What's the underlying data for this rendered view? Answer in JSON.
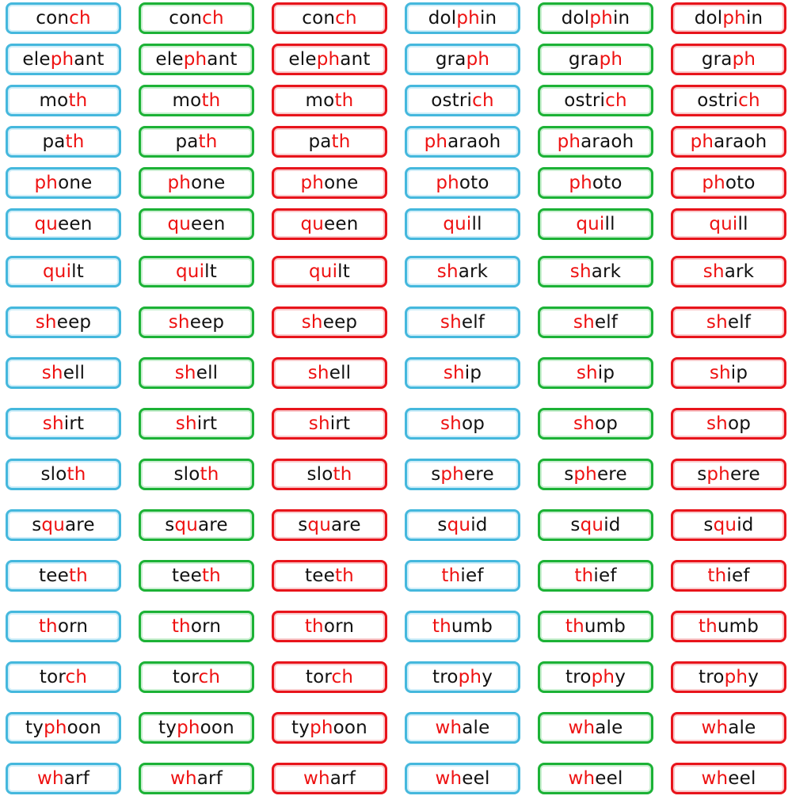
{
  "theme": {
    "blue": "#45b8dd",
    "green": "#1cb236",
    "red": "#e8141b",
    "highlight": "#ee1111",
    "text": "#111111"
  },
  "card_colors": [
    "blue",
    "green",
    "red"
  ],
  "rows": [
    {
      "words": [
        {
          "pre": "con",
          "hl": "ch",
          "post": ""
        },
        {
          "pre": "dol",
          "hl": "ph",
          "post": "in"
        }
      ]
    },
    {
      "words": [
        {
          "pre": "ele",
          "hl": "ph",
          "post": "ant"
        },
        {
          "pre": "gra",
          "hl": "ph",
          "post": ""
        }
      ]
    },
    {
      "words": [
        {
          "pre": "mo",
          "hl": "th",
          "post": ""
        },
        {
          "pre": "ostri",
          "hl": "ch",
          "post": ""
        }
      ]
    },
    {
      "words": [
        {
          "pre": "pa",
          "hl": "th",
          "post": ""
        },
        {
          "pre": "",
          "hl": "ph",
          "post": "araoh"
        }
      ]
    },
    {
      "words": [
        {
          "pre": "",
          "hl": "ph",
          "post": "one"
        },
        {
          "pre": "",
          "hl": "ph",
          "post": "oto"
        }
      ]
    },
    {
      "words": [
        {
          "pre": "",
          "hl": "qu",
          "post": "een"
        },
        {
          "pre": "",
          "hl": "qui",
          "post": "ll"
        }
      ]
    },
    {
      "words": [
        {
          "pre": "",
          "hl": "qui",
          "post": "lt"
        },
        {
          "pre": "",
          "hl": "sh",
          "post": "ark"
        }
      ]
    },
    {
      "words": [
        {
          "pre": "",
          "hl": "sh",
          "post": "eep"
        },
        {
          "pre": "",
          "hl": "sh",
          "post": "elf"
        }
      ]
    },
    {
      "words": [
        {
          "pre": "",
          "hl": "sh",
          "post": "ell"
        },
        {
          "pre": "",
          "hl": "sh",
          "post": "ip"
        }
      ]
    },
    {
      "words": [
        {
          "pre": "",
          "hl": "sh",
          "post": "irt"
        },
        {
          "pre": "",
          "hl": "sh",
          "post": "op"
        }
      ]
    },
    {
      "words": [
        {
          "pre": "slo",
          "hl": "th",
          "post": ""
        },
        {
          "pre": "s",
          "hl": "ph",
          "post": "ere"
        }
      ]
    },
    {
      "words": [
        {
          "pre": "s",
          "hl": "qu",
          "post": "are"
        },
        {
          "pre": "s",
          "hl": "qu",
          "post": "id"
        }
      ]
    },
    {
      "words": [
        {
          "pre": "tee",
          "hl": "th",
          "post": ""
        },
        {
          "pre": "",
          "hl": "th",
          "post": "ief"
        }
      ]
    },
    {
      "words": [
        {
          "pre": "",
          "hl": "th",
          "post": "orn"
        },
        {
          "pre": "",
          "hl": "th",
          "post": "umb"
        }
      ]
    },
    {
      "words": [
        {
          "pre": "tor",
          "hl": "ch",
          "post": ""
        },
        {
          "pre": "tro",
          "hl": "ph",
          "post": "y"
        }
      ]
    },
    {
      "words": [
        {
          "pre": "ty",
          "hl": "ph",
          "post": "oon"
        },
        {
          "pre": "",
          "hl": "wh",
          "post": "ale"
        }
      ]
    },
    {
      "words": [
        {
          "pre": "",
          "hl": "wh",
          "post": "arf"
        },
        {
          "pre": "",
          "hl": "wh",
          "post": "eel"
        }
      ]
    }
  ]
}
